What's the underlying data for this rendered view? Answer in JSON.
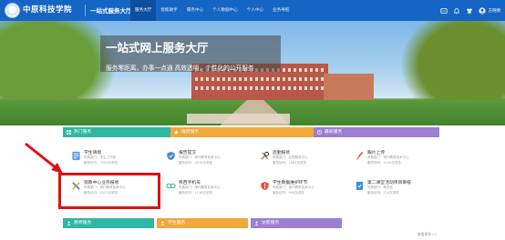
{
  "header": {
    "school_name": "中原科技学院",
    "portal_title": "一站式服务大厅",
    "nav": [
      {
        "label": "服务大厅",
        "active": true
      },
      {
        "label": "智能助手"
      },
      {
        "label": "服务中心"
      },
      {
        "label": "个人数据中心"
      },
      {
        "label": "个人中心"
      },
      {
        "label": "业务导航"
      }
    ],
    "user_label": "方晓明"
  },
  "banner": {
    "title": "一站式网上服务大厅",
    "subtitle": "服务零距离，办事一点通 高效透明，个性化的公开服务"
  },
  "services": {
    "columns": [
      {
        "label": "热门服务",
        "color": "#2fb7a3"
      },
      {
        "label": "推荐服务",
        "color": "#f0a83a"
      },
      {
        "label": "最新服务",
        "color": "#9c7fcf"
      }
    ],
    "tiles": [
      {
        "title": "学生请假",
        "dept": "所属部门：学生工作部",
        "views": "服务访问：7224次浏览"
      },
      {
        "title": "报告提交",
        "dept": "所属部门：现代教育技术中心",
        "views": "服务访问：4515次浏览"
      },
      {
        "title": "后勤报修",
        "dept": "所属部门：后勤服务中心",
        "views": "服务访问：1584次浏览"
      },
      {
        "title": "跟片上传",
        "dept": "所属部门：现代教育技术中心",
        "views": "服务访问：1125次浏览"
      },
      {
        "title": "现教中心业务报修",
        "dept": "所属部门：现代教育技术中心",
        "views": "服务访问：1121次浏览"
      },
      {
        "title": "移西手机号",
        "dept": "所属部门：现代教育技术中心",
        "views": "服务访问：1118次浏览"
      },
      {
        "title": "学生数据维护环节",
        "dept": "所属部门：现代教育技术中心",
        "views": "服务访问：904次浏览"
      },
      {
        "title": "第二课堂活动项目审核",
        "dept": "所属部门：教务处",
        "views": "服务访问：724次浏览"
      }
    ],
    "more_label": "查看更多>>",
    "bottom_columns": [
      {
        "label": "教师服务",
        "color": "#2fb7a3"
      },
      {
        "label": "学生服务",
        "color": "#f0a83a"
      },
      {
        "label": "访客服务",
        "color": "#9c7fcf"
      }
    ]
  }
}
